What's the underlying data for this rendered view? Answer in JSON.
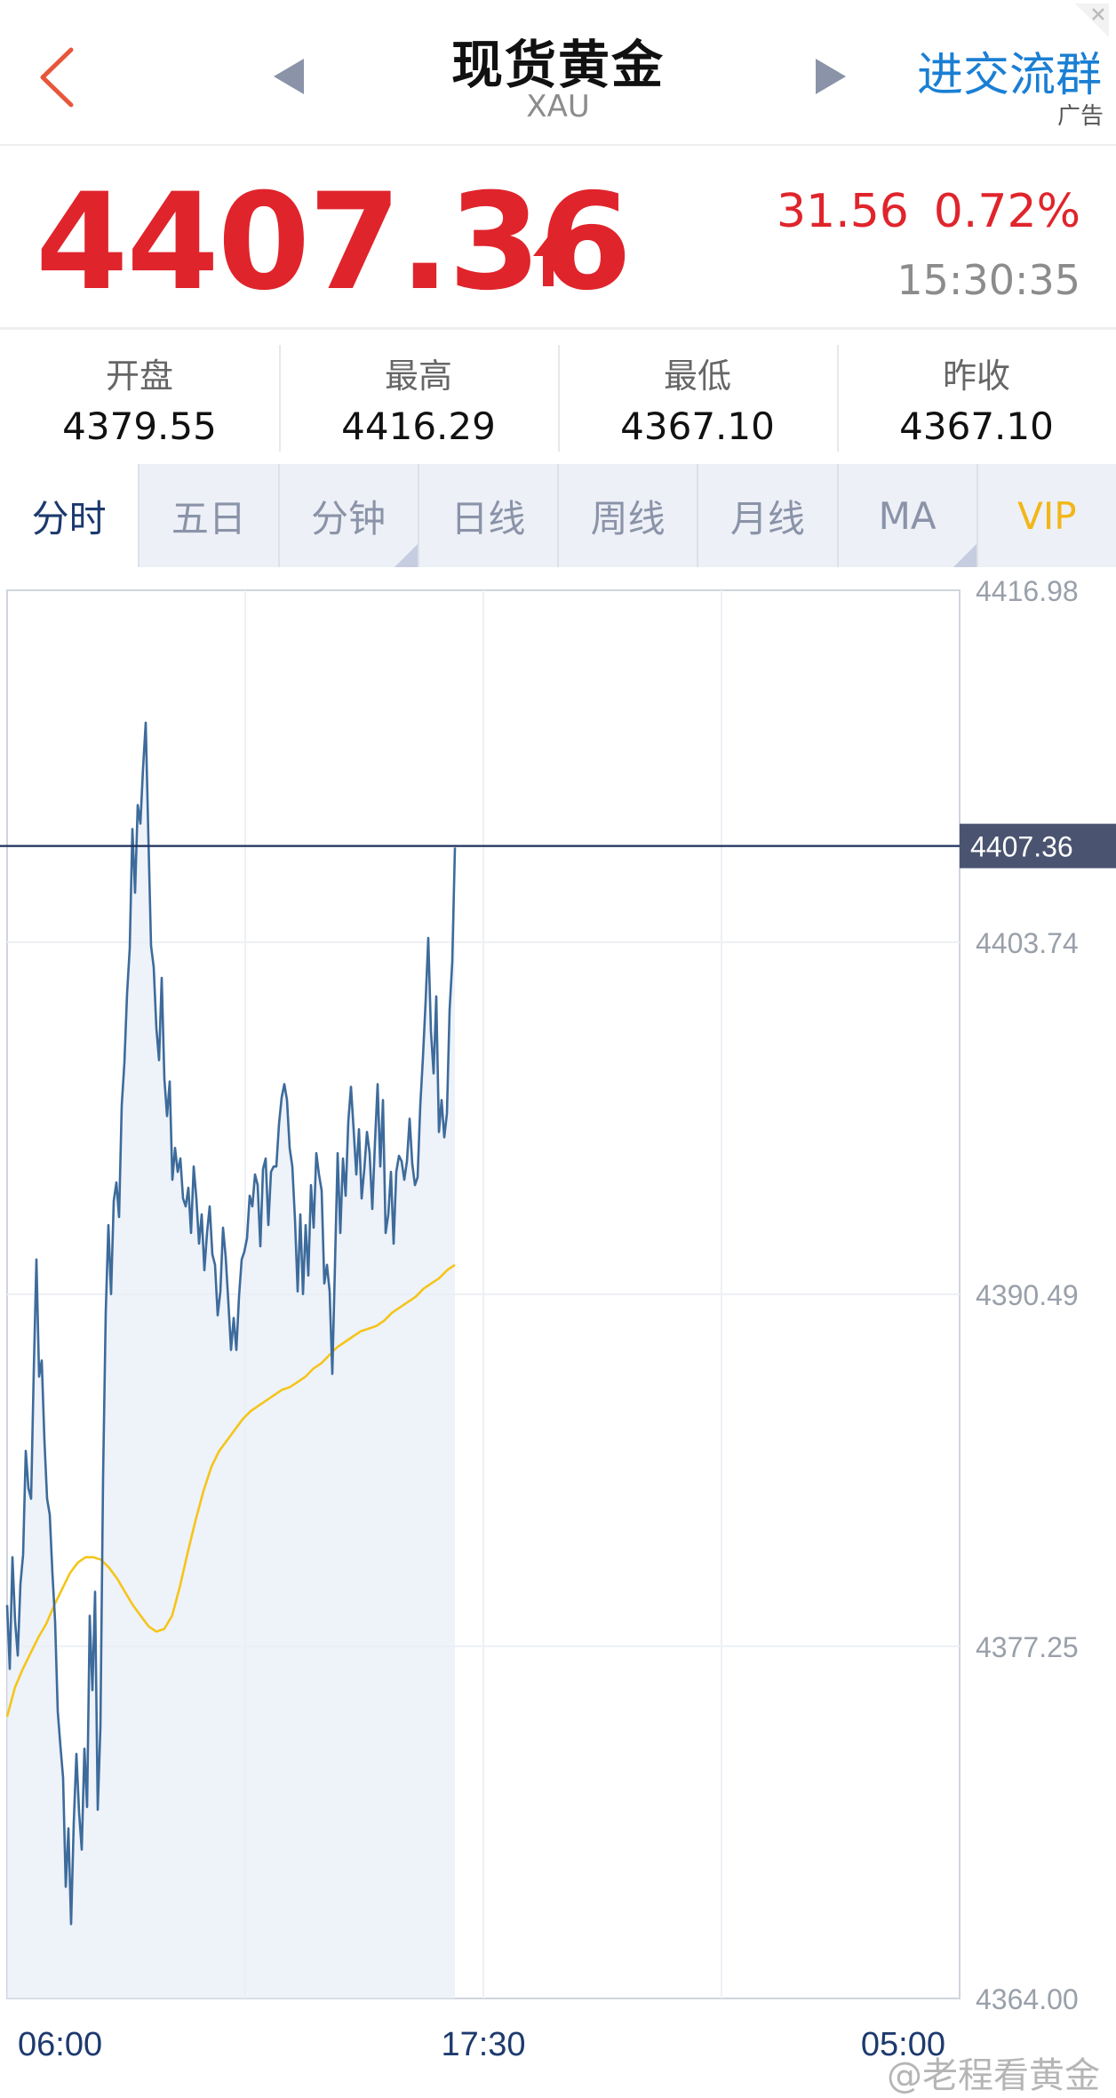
{
  "header": {
    "title": "现货黄金",
    "subtitle": "XAU",
    "ad_link": "进交流群",
    "ad_tag": "广告"
  },
  "quote": {
    "price": "4407.36",
    "change": "31.56",
    "change_pct": "0.72%",
    "time": "15:30:35",
    "color_up": "#e0242b"
  },
  "stats": [
    {
      "label": "开盘",
      "value": "4379.55"
    },
    {
      "label": "最高",
      "value": "4416.29"
    },
    {
      "label": "最低",
      "value": "4367.10"
    },
    {
      "label": "昨收",
      "value": "4367.10"
    }
  ],
  "tabs": [
    {
      "label": "分时",
      "active": true,
      "corner": false
    },
    {
      "label": "五日",
      "active": false,
      "corner": false
    },
    {
      "label": "分钟",
      "active": false,
      "corner": true
    },
    {
      "label": "日线",
      "active": false,
      "corner": false
    },
    {
      "label": "周线",
      "active": false,
      "corner": false
    },
    {
      "label": "月线",
      "active": false,
      "corner": false
    },
    {
      "label": "MA",
      "active": false,
      "corner": true
    },
    {
      "label": "VIP",
      "active": false,
      "corner": false
    }
  ],
  "watermark": "@老程看黄金",
  "chart_data": {
    "type": "line",
    "x_ticks": [
      "06:00",
      "17:30",
      "05:00"
    ],
    "y_ticks": [
      "4416.98",
      "4403.74",
      "4390.49",
      "4377.25",
      "4364.00"
    ],
    "ylim": [
      4364.0,
      4416.98
    ],
    "current_price": 4407.36,
    "current_price_label": "4407.36",
    "grid": true,
    "colors": {
      "price": "#3d6b9b",
      "average": "#f5c518",
      "current": "#1d2f5a",
      "fill": "#e8eef7"
    },
    "series": [
      {
        "values": [
          4378.8,
          4376.4,
          4380.6,
          4378.2,
          4376.9,
          4379.6,
          4380.7,
          4384.6,
          4383.2,
          4382.8,
          4387.6,
          4391.8,
          4387.4,
          4388.0,
          4385.0,
          4382.8,
          4382.2,
          4380.0,
          4378.2,
          4374.8,
          4373.5,
          4372.3,
          4368.2,
          4370.4,
          4366.8,
          4370.6,
          4373.2,
          4371.0,
          4369.6,
          4373.4,
          4371.2,
          4378.4,
          4375.6,
          4379.3,
          4371.1,
          4374.2,
          4383.6,
          4389.8,
          4393.1,
          4390.5,
          4394.0,
          4394.7,
          4393.4,
          4397.6,
          4399.2,
          4401.8,
          4403.5,
          4408.0,
          4405.6,
          4408.9,
          4408.2,
          4410.3,
          4412.0,
          4407.7,
          4403.6,
          4402.8,
          4400.5,
          4399.3,
          4402.4,
          4398.6,
          4397.2,
          4398.5,
          4394.8,
          4396.0,
          4395.1,
          4395.6,
          4394.1,
          4393.8,
          4394.5,
          4392.8,
          4395.3,
          4394.1,
          4392.4,
          4393.5,
          4391.4,
          4392.8,
          4393.8,
          4392.0,
          4391.6,
          4389.7,
          4390.6,
          4393.0,
          4391.9,
          4390.2,
          4388.4,
          4389.6,
          4388.4,
          4390.4,
          4391.8,
          4392.1,
          4392.6,
          4394.2,
          4393.8,
          4395.0,
          4394.6,
          4392.3,
          4395.2,
          4395.6,
          4393.1,
          4395.1,
          4395.3,
          4395.3,
          4396.9,
          4397.9,
          4398.4,
          4397.8,
          4396.0,
          4395.3,
          4393.3,
          4390.6,
          4393.5,
          4390.5,
          4393.1,
          4391.2,
          4394.6,
          4393.0,
          4395.8,
          4395.0,
          4394.4,
          4390.9,
          4391.6,
          4390.6,
          4387.5,
          4391.6,
          4395.8,
          4392.8,
          4395.6,
          4394.2,
          4397.0,
          4398.3,
          4396.7,
          4395.0,
          4396.7,
          4394.1,
          4395.2,
          4396.6,
          4395.8,
          4393.7,
          4396.2,
          4398.4,
          4395.3,
          4397.8,
          4392.8,
          4393.5,
          4395.1,
          4392.4,
          4395.1,
          4395.7,
          4395.5,
          4394.8,
          4395.5,
          4397.1,
          4395.4,
          4394.6,
          4394.9,
          4397.6,
          4399.4,
          4401.5,
          4403.9,
          4400.4,
          4398.8,
          4401.7,
          4396.6,
          4397.8,
          4396.4,
          4397.3,
          4401.2,
          4403.0,
          4407.3
        ],
        "x_max": 512
      },
      {
        "values": [
          4374.6,
          4375.7,
          4376.4,
          4377.0,
          4377.6,
          4378.1,
          4378.8,
          4379.4,
          4380.0,
          4380.4,
          4380.6,
          4380.6,
          4380.5,
          4380.2,
          4379.8,
          4379.3,
          4378.8,
          4378.4,
          4378.0,
          4377.8,
          4377.9,
          4378.4,
          4379.5,
          4380.8,
          4382.0,
          4383.1,
          4384.0,
          4384.6,
          4385.0,
          4385.4,
          4385.8,
          4386.1,
          4386.3,
          4386.5,
          4386.7,
          4386.9,
          4387.0,
          4387.2,
          4387.4,
          4387.7,
          4387.9,
          4388.2,
          4388.5,
          4388.7,
          4388.9,
          4389.1,
          4389.2,
          4389.3,
          4389.5,
          4389.8,
          4390.0,
          4390.2,
          4390.4,
          4390.7,
          4390.9,
          4391.1,
          4391.4,
          4391.6
        ],
        "x_max": 512
      }
    ]
  }
}
